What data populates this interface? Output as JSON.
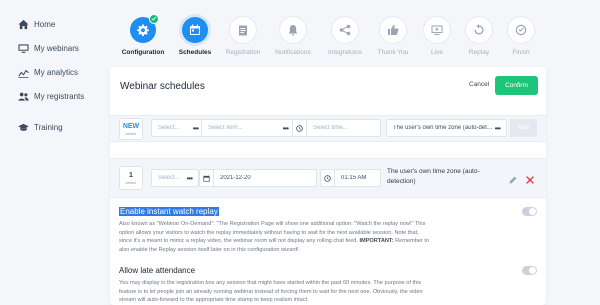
{
  "sidebar": {
    "items": [
      {
        "label": "Home",
        "icon": "home-icon"
      },
      {
        "label": "My webinars",
        "icon": "monitor-icon"
      },
      {
        "label": "My analytics",
        "icon": "analytics-icon"
      },
      {
        "label": "My registrants",
        "icon": "users-icon"
      },
      {
        "label": "Training",
        "icon": "graduation-cap-icon"
      }
    ]
  },
  "steps": [
    {
      "label": "Configuration",
      "state": "done",
      "icon": "gear-icon"
    },
    {
      "label": "Schedules",
      "state": "active",
      "icon": "calendar-icon"
    },
    {
      "label": "Registration",
      "state": "pending",
      "icon": "clipboard-icon"
    },
    {
      "label": "Notifications",
      "state": "pending",
      "icon": "bell-icon"
    },
    {
      "label": "Integrations",
      "state": "pending",
      "icon": "share-icon"
    },
    {
      "label": "Thank You",
      "state": "pending",
      "icon": "thumbs-up-icon"
    },
    {
      "label": "Live",
      "state": "pending",
      "icon": "live-screen-icon"
    },
    {
      "label": "Replay",
      "state": "pending",
      "icon": "replay-icon"
    },
    {
      "label": "Finish",
      "state": "pending",
      "icon": "check-circle-icon"
    }
  ],
  "header": {
    "title": "Webinar schedules",
    "cancel_label": "Cancel",
    "confirm_label": "Confirm"
  },
  "new_row": {
    "badge": "NEW",
    "badge_sub": "series",
    "select_placeholder": "Select...",
    "item_placeholder": "Select item...",
    "time_placeholder": "Select time...",
    "timezone": "The user's own time zone (auto-detection)",
    "add_label": "Add"
  },
  "edit_row": {
    "badge": "1",
    "badge_sub": "series",
    "select_placeholder": "Select...",
    "date": "2021-12-20",
    "time": "01:15 AM",
    "timezone_line1": "The user's own time zone (auto-",
    "timezone_line2": "detection)"
  },
  "options": [
    {
      "title": "Enable instant watch replay",
      "lines": [
        "Also known as \"Webinar On-Demand\": \"The Registration Page will show one additional option: \"Watch the replay now!\" This",
        "option allows your visitors to watch the replay immediately without having to wait for the next available session. Note that,",
        "since it's a meant to mimic a replay video, the webinar room will not display any rolling chat feed.",
        "IMPORTANT:",
        " Remember to",
        "also enable the Replay session itself later on in this configuration wizard!"
      ]
    },
    {
      "title": "Allow late attendance",
      "lines": [
        "You may display in the registration box any session that might have started within the past 60 minutes. The purpose of this",
        "feature is to let people join an already running webinar instead of forcing them to wait for the next one. Obviously, the video",
        "stream will auto-forward to the appropriate time stamp to keep realism intact."
      ]
    }
  ],
  "colors": {
    "accent": "#1f8ef1",
    "confirm": "#1fc47b",
    "highlight": "#2f7be0",
    "delete": "#e03a3a"
  }
}
